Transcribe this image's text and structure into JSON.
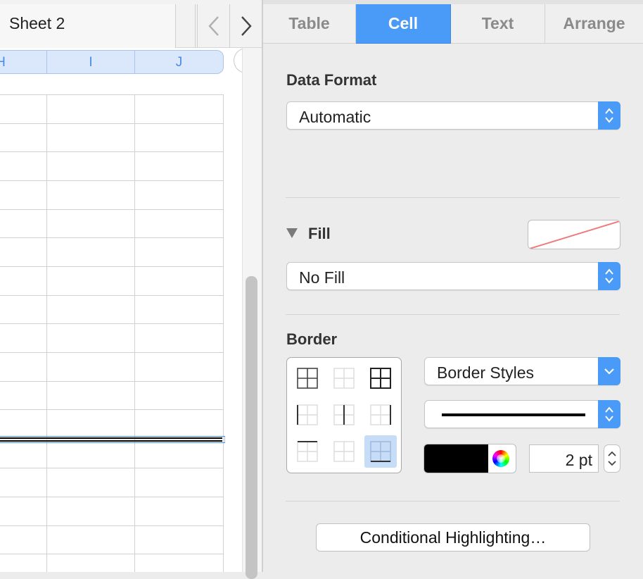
{
  "sheet": {
    "tab_label": "Sheet 2",
    "columns": [
      "H",
      "I",
      "J"
    ]
  },
  "inspector": {
    "tabs": [
      {
        "label": "Table",
        "active": false
      },
      {
        "label": "Cell",
        "active": true
      },
      {
        "label": "Text",
        "active": false
      },
      {
        "label": "Arrange",
        "active": false
      }
    ],
    "data_format": {
      "title": "Data Format",
      "value": "Automatic"
    },
    "fill": {
      "title": "Fill",
      "value": "No Fill"
    },
    "border": {
      "title": "Border",
      "styles_label": "Border Styles",
      "width_value": "2 pt",
      "color": "#000000"
    },
    "conditional_highlighting_label": "Conditional Highlighting…"
  },
  "colors": {
    "accent": "#4a9af7",
    "grid_line": "#d0d0d0",
    "header_fill": "#dbe8fb"
  }
}
